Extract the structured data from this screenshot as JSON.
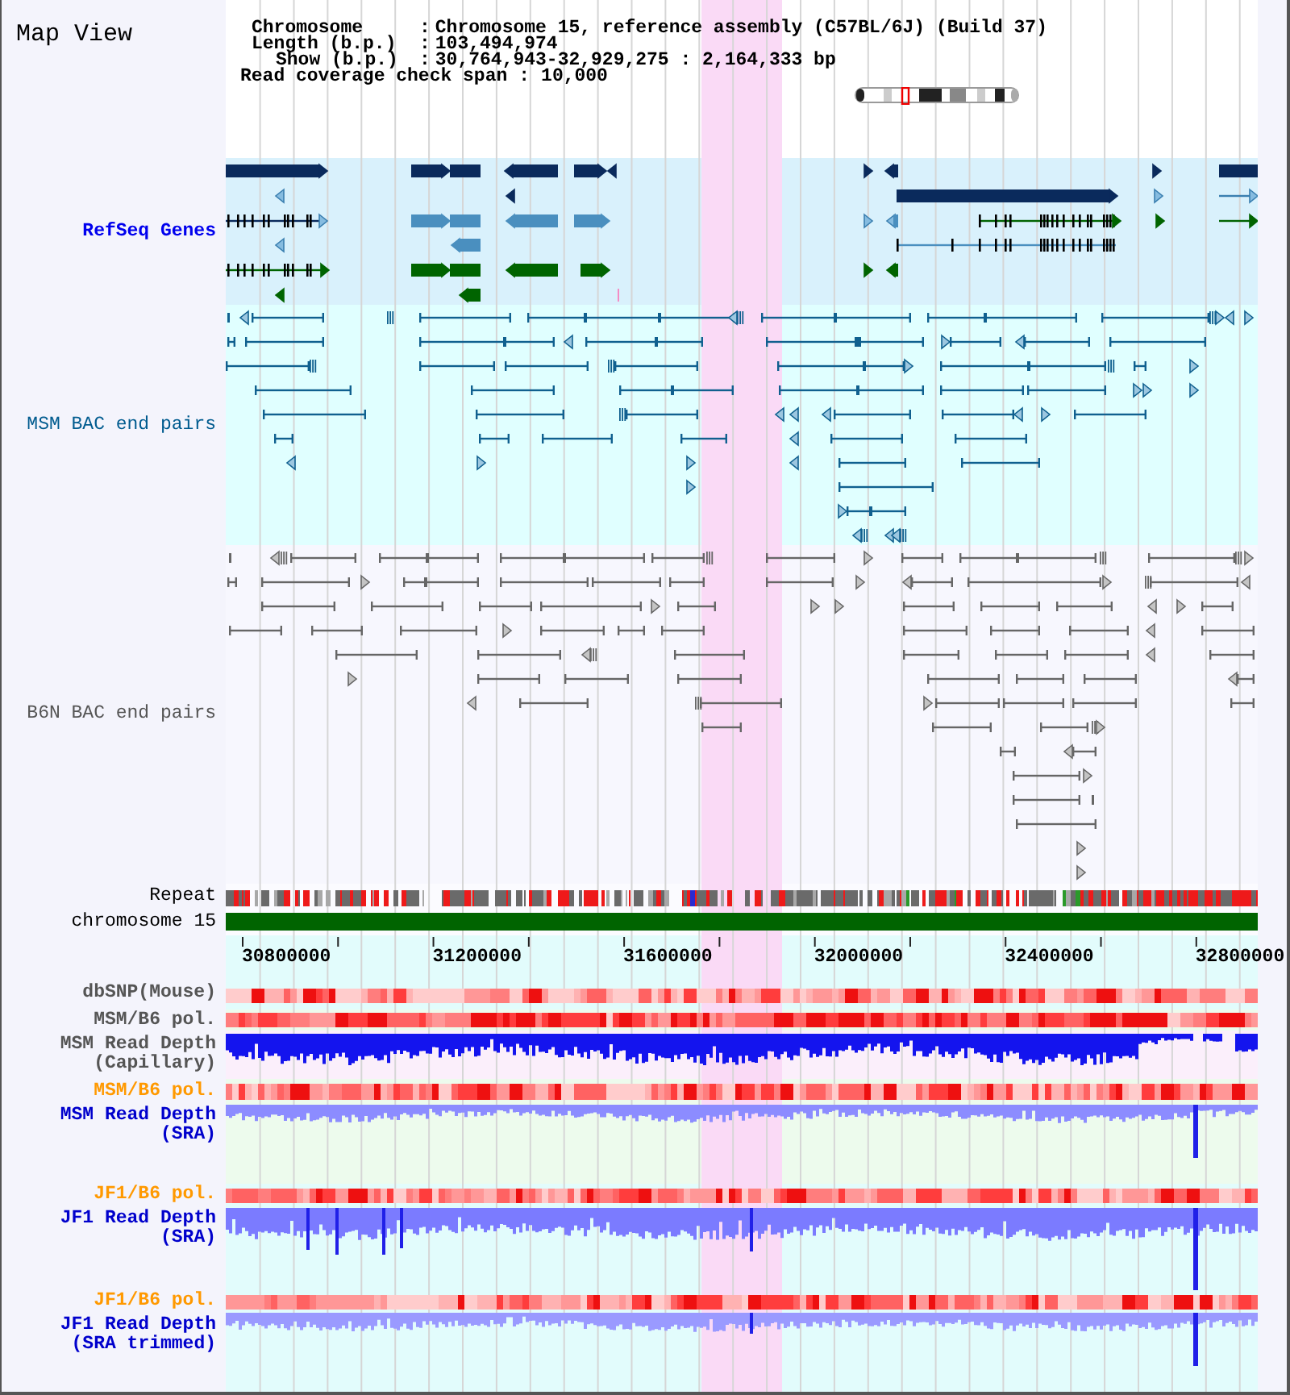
{
  "panel_title": "Map View",
  "info": [
    {
      "label": "Chromosome",
      "sep": ":",
      "value": "Chromosome 15, reference assembly (C57BL/6J) (Build 37)"
    },
    {
      "label": "Length (b.p.)",
      "sep": ":",
      "value": "103,494,974"
    },
    {
      "label": "Show (b.p.)",
      "sep": ":",
      "value": "30,764,943-32,929,275 : 2,164,333 bp"
    },
    {
      "label": "Read coverage check span",
      "sep": ":",
      "value": "10,000"
    }
  ],
  "tracks": [
    {
      "kind": "genes",
      "label": "RefSeq Genes",
      "color": "#0000ee"
    },
    {
      "kind": "bac",
      "label": "MSM BAC end pairs",
      "color": "#005b8f"
    },
    {
      "kind": "bac",
      "label": "B6N BAC end pairs",
      "color": "#555555"
    },
    {
      "kind": "repeat",
      "label": "Repeat",
      "color": "#000000"
    },
    {
      "kind": "chromosome",
      "label": "chromosome 15",
      "color": "#000000"
    },
    {
      "kind": "axis",
      "ticks": [
        "30800000",
        "31200000",
        "31600000",
        "32000000",
        "32400000",
        "32800000"
      ]
    },
    {
      "kind": "heatmap",
      "label": "dbSNP(Mouse)",
      "color": "#555555"
    },
    {
      "kind": "heatmap",
      "label": "MSM/B6 pol.",
      "color": "#555555"
    },
    {
      "kind": "depth",
      "label": "MSM Read Depth (Capillary)",
      "color": "#555555"
    },
    {
      "kind": "heatmap",
      "label": "MSM/B6 pol.",
      "color": "#ff9900"
    },
    {
      "kind": "depth",
      "label": "MSM Read Depth (SRA)",
      "color": "#0000cc"
    },
    {
      "kind": "heatmap",
      "label": "JF1/B6 pol.",
      "color": "#ff9900"
    },
    {
      "kind": "depth",
      "label": "JF1 Read Depth (SRA)",
      "color": "#0000cc"
    },
    {
      "kind": "heatmap",
      "label": "JF1/B6 pol.",
      "color": "#ff9900"
    },
    {
      "kind": "depth",
      "label": "JF1 Read Depth (SRA trimmed)",
      "color": "#0000cc"
    }
  ]
}
